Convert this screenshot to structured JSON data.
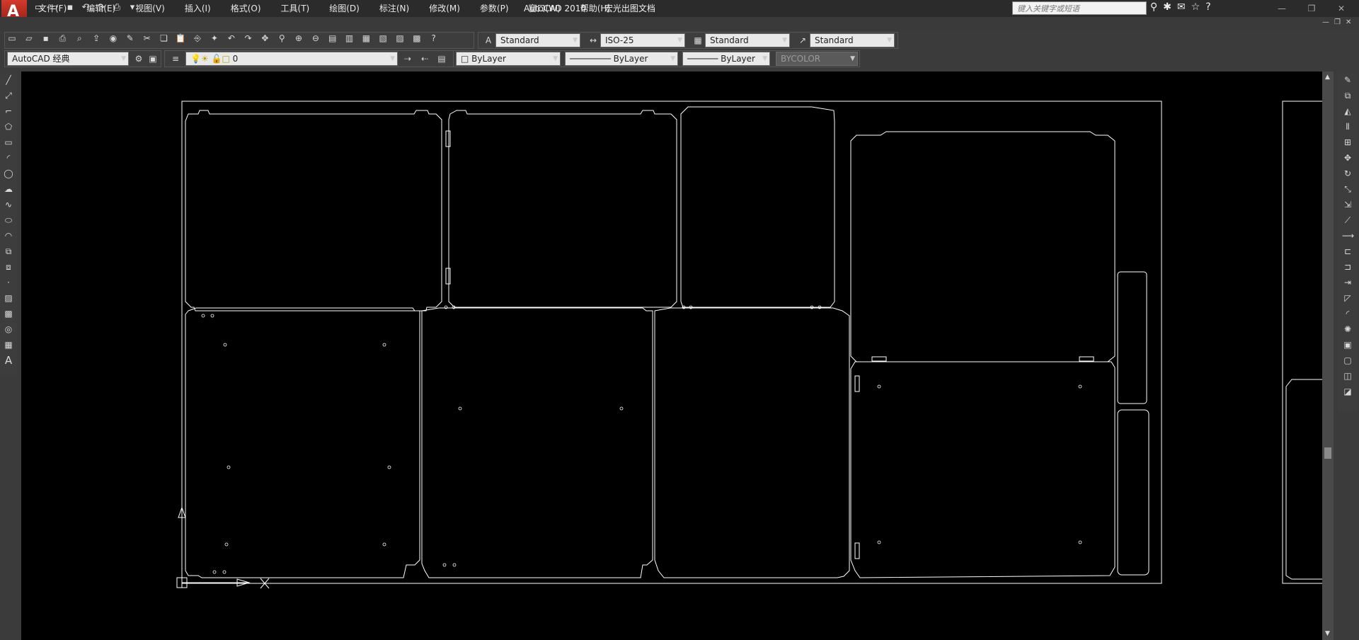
{
  "title": {
    "app": "AutoCAD 2010",
    "document": "宏光出图文档",
    "search_placeholder": "键入关键字或短语"
  },
  "menu": [
    "文件(F)",
    "编辑(E)",
    "视图(V)",
    "插入(I)",
    "格式(O)",
    "工具(T)",
    "绘图(D)",
    "标注(N)",
    "修改(M)",
    "参数(P)",
    "窗口(W)",
    "帮助(H)"
  ],
  "styles": {
    "text_style": "Standard",
    "dim_style": "ISO-25",
    "table_style": "Standard",
    "multileader_style": "Standard"
  },
  "workspace": "AutoCAD 经典",
  "layer": "0",
  "properties": {
    "color": "ByLayer",
    "linetype": "ByLayer",
    "lineweight": "ByLayer",
    "plotstyle": "BYCOLOR"
  },
  "icons": {
    "logo_letter": "A"
  }
}
